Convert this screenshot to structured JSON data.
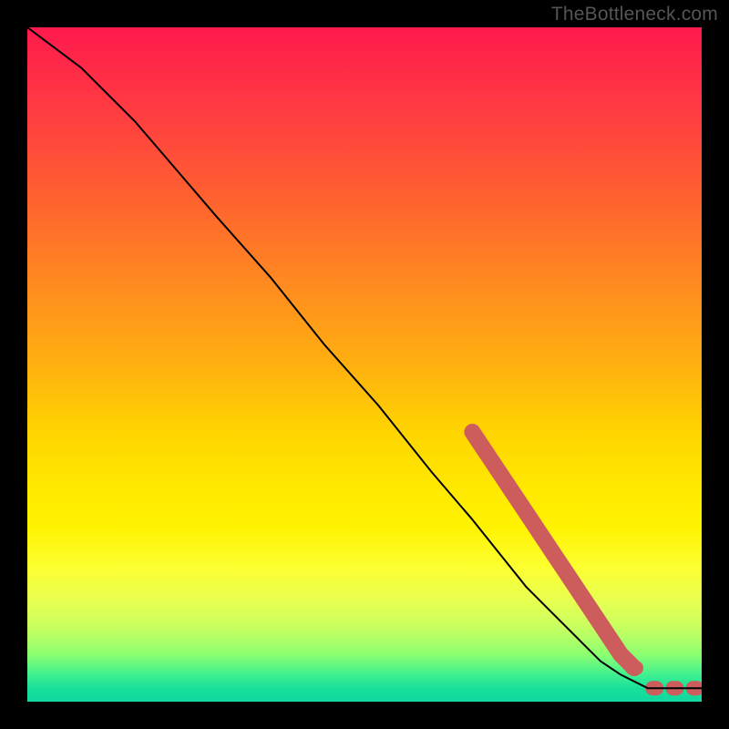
{
  "watermark": "TheBottleneck.com",
  "colors": {
    "marker": "#cd5c5c",
    "line": "#000000"
  },
  "chart_data": {
    "type": "line",
    "title": "",
    "xlabel": "",
    "ylabel": "",
    "xlim": [
      0,
      100
    ],
    "ylim": [
      0,
      100
    ],
    "grid": false,
    "legend": false,
    "series": [
      {
        "name": "curve",
        "x": [
          0,
          4,
          8,
          12,
          16,
          22,
          28,
          36,
          44,
          52,
          60,
          66,
          70,
          74,
          78,
          82,
          85,
          88,
          90,
          92,
          94,
          96,
          98,
          100
        ],
        "y": [
          100,
          97,
          94,
          90,
          86,
          79,
          72,
          63,
          53,
          44,
          34,
          27,
          22,
          17,
          13,
          9,
          6,
          4,
          3,
          2,
          2,
          2,
          2,
          2
        ]
      }
    ],
    "markers": {
      "name": "highlighted-segment",
      "x": [
        66,
        68,
        70,
        72,
        74,
        76,
        78,
        80,
        82,
        84,
        86,
        88,
        90,
        93,
        96,
        99
      ],
      "y": [
        40,
        37,
        34,
        31,
        28,
        25,
        22,
        19,
        16,
        13,
        10,
        7,
        5,
        2,
        2,
        2
      ]
    }
  }
}
